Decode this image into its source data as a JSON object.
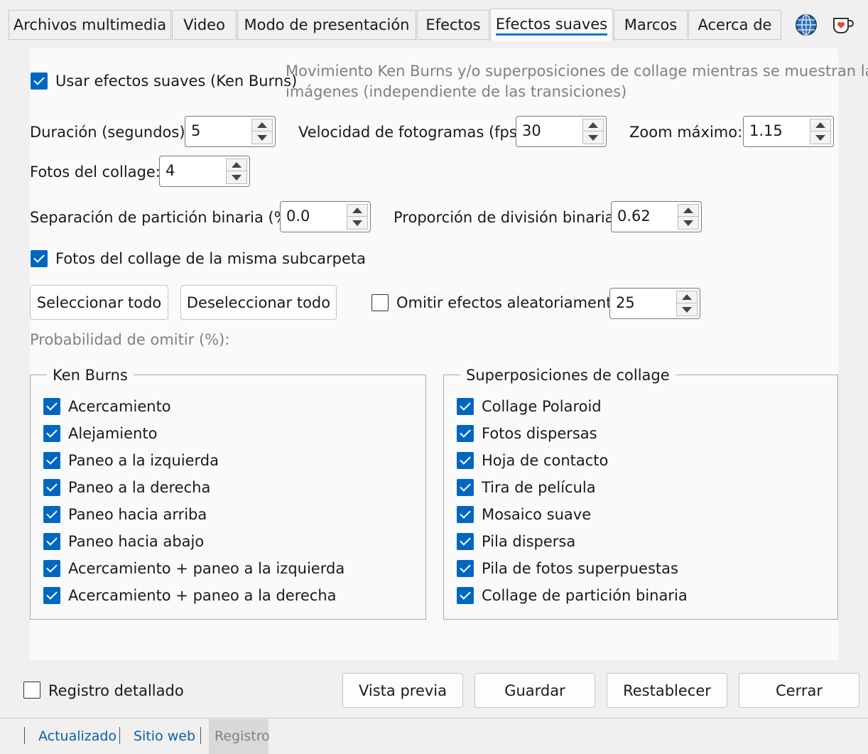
{
  "tabs": [
    {
      "label": "Archivos multimedia"
    },
    {
      "label": "Video"
    },
    {
      "label": "Modo de presentación"
    },
    {
      "label": "Efectos"
    },
    {
      "label": "Efectos suaves",
      "active": true
    },
    {
      "label": "Marcos"
    },
    {
      "label": "Acerca de"
    }
  ],
  "header_icons": {
    "language": "globe-icon",
    "support": "coffee-heart-icon"
  },
  "smooth": {
    "use_label": "Usar efectos suaves (Ken Burns)",
    "use_checked": true,
    "description_line1": "Movimiento Ken Burns y/o superposiciones de collage mientras se muestran las",
    "description_line2": "imágenes (independiente de las transiciones)"
  },
  "fields": {
    "duration_label": "Duración (segundos):",
    "duration_value": "5",
    "fps_label": "Velocidad de fotogramas (fps):",
    "fps_value": "30",
    "zoom_label": "Zoom máximo:",
    "zoom_value": "1.15",
    "collage_photos_label": "Fotos del collage:",
    "collage_photos_value": "4",
    "bsp_gap_label": "Separación de partición binaria (%):",
    "bsp_gap_value": "0.0",
    "bsp_ratio_label": "Proporción de división binaria:",
    "bsp_ratio_value": "0.62"
  },
  "same_folder": {
    "label": "Fotos del collage de la misma subcarpeta",
    "checked": true
  },
  "actions": {
    "select_all": "Seleccionar todo",
    "deselect_all": "Deseleccionar todo"
  },
  "skip": {
    "label": "Omitir efectos aleatoriamente",
    "checked": false,
    "value": "25",
    "probability_label": "Probabilidad de omitir (%):"
  },
  "ken_burns": {
    "title": "Ken Burns",
    "items": [
      {
        "label": "Acercamiento",
        "checked": true
      },
      {
        "label": "Alejamiento",
        "checked": true
      },
      {
        "label": "Paneo a la izquierda",
        "checked": true
      },
      {
        "label": "Paneo a la derecha",
        "checked": true
      },
      {
        "label": "Paneo hacia arriba",
        "checked": true
      },
      {
        "label": "Paneo hacia abajo",
        "checked": true
      },
      {
        "label": "Acercamiento + paneo a la izquierda",
        "checked": true
      },
      {
        "label": "Acercamiento + paneo a la derecha",
        "checked": true
      }
    ]
  },
  "collage": {
    "title": "Superposiciones de collage",
    "items": [
      {
        "label": "Collage Polaroid",
        "checked": true
      },
      {
        "label": "Fotos dispersas",
        "checked": true
      },
      {
        "label": "Hoja de contacto",
        "checked": true
      },
      {
        "label": "Tira de película",
        "checked": true
      },
      {
        "label": "Mosaico suave",
        "checked": true
      },
      {
        "label": "Pila dispersa",
        "checked": true
      },
      {
        "label": "Pila de fotos superpuestas",
        "checked": true
      },
      {
        "label": "Collage de partición binaria",
        "checked": true
      }
    ]
  },
  "footer": {
    "verbose_label": "Registro detallado",
    "verbose_checked": false,
    "preview": "Vista previa",
    "save": "Guardar",
    "reset": "Restablecer",
    "close": "Cerrar"
  },
  "statusbar": {
    "updated": "Actualizado",
    "website": "Sitio web",
    "log": "Registro"
  },
  "colors": {
    "accent": "#0067c0",
    "link": "#0a5ea8",
    "tab_underline": "#0078d4"
  }
}
